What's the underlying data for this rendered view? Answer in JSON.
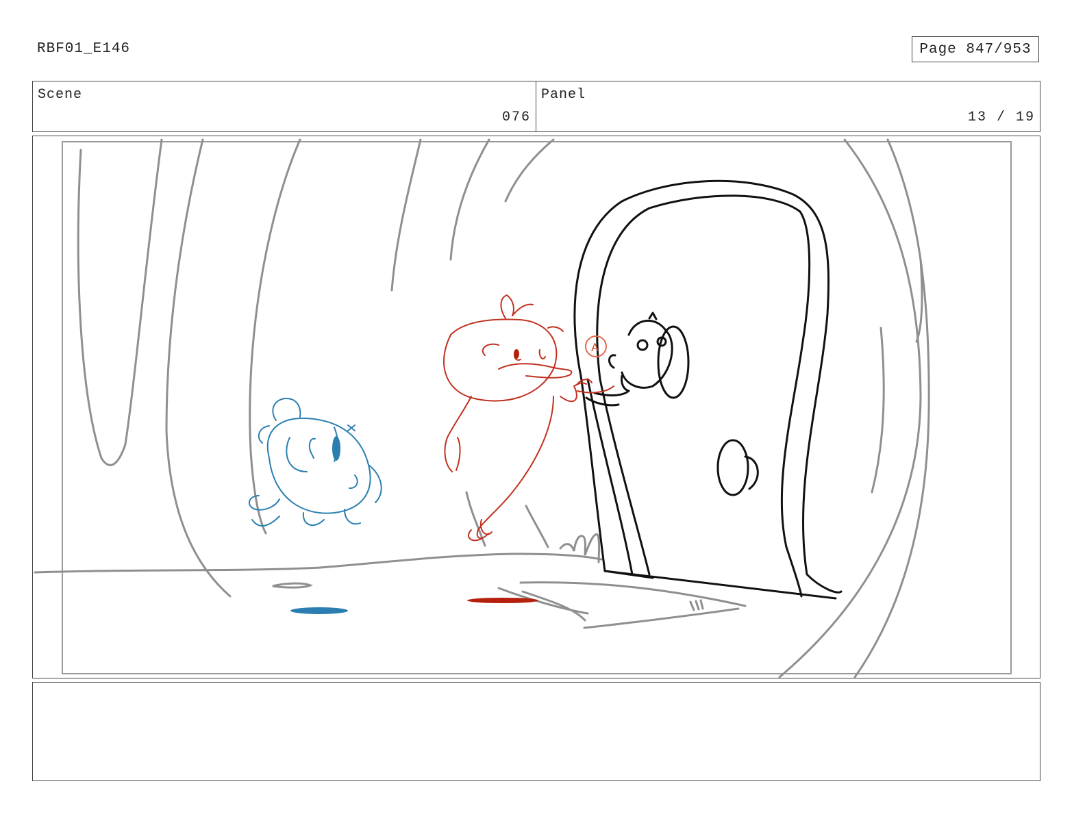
{
  "header": {
    "production_code": "RBF01_E146",
    "page_indicator": "Page 847/953"
  },
  "scene": {
    "label": "Scene",
    "value": "076"
  },
  "panel": {
    "label": "Panel",
    "value": "13 / 19"
  },
  "drawing": {
    "line_colors": {
      "background_gray": "#8f8f8f",
      "gumball_blue": "#2a7fb0",
      "darwin_red": "#c0311f",
      "door_black": "#111111"
    },
    "annotation_mark": "A"
  },
  "notes": {
    "text": ""
  }
}
